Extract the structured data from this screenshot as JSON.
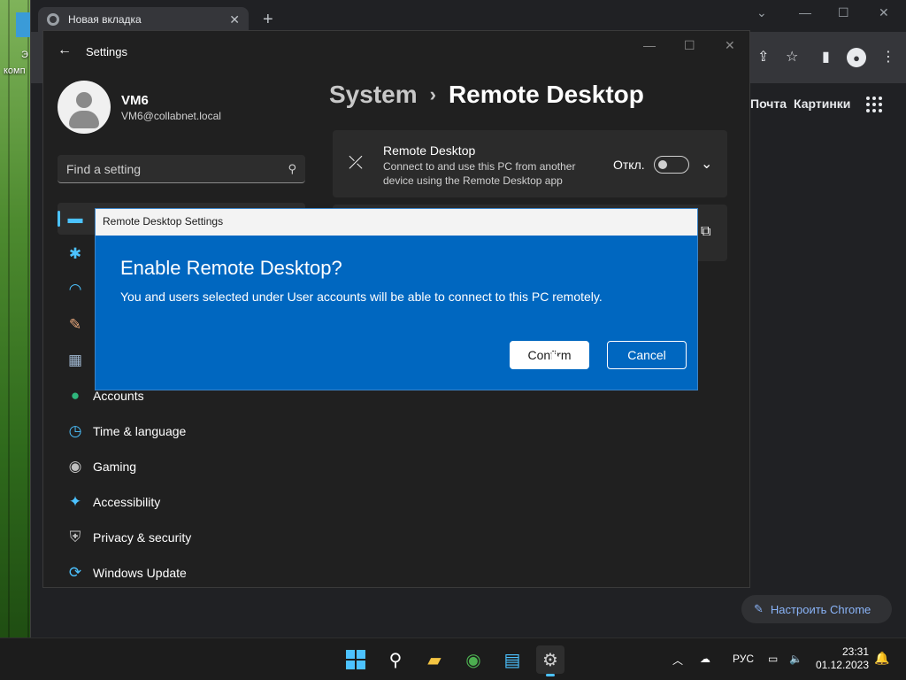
{
  "desktop": {
    "icon_fragment_1": "Э",
    "icon_fragment_2": "комп"
  },
  "chrome": {
    "tab_title": "Новая вкладка",
    "tab_close": "✕",
    "new_tab": "+",
    "window_controls": {
      "list": "⌄",
      "minimize": "—",
      "maximize": "☐",
      "close": "✕"
    },
    "toolbar_icons": {
      "share": "⇪",
      "bookmark": "☆",
      "sidepanel": "▮",
      "profile": "●",
      "menu": "⋮"
    },
    "links": {
      "mail": "Почта",
      "images": "Картинки"
    },
    "customize_label": "Настроить Chrome",
    "customize_icon": "✎"
  },
  "settings": {
    "window_title": "Settings",
    "back": "←",
    "window_controls": {
      "minimize": "—",
      "maximize": "☐",
      "close": "✕"
    },
    "user": {
      "name": "VM6",
      "email": "VM6@collabnet.local"
    },
    "search_placeholder": "Find a setting",
    "search_icon": "⚲",
    "nav": [
      {
        "icon": "▬",
        "label": "",
        "color": "#4cc2ff"
      },
      {
        "icon": "✱",
        "label": "",
        "color": "#4cc2ff"
      },
      {
        "icon": "◠",
        "label": "",
        "color": "#4cc2ff"
      },
      {
        "icon": "✎",
        "label": "",
        "color": "#e8a87c"
      },
      {
        "icon": "▦",
        "label": "",
        "color": "#9fb6cf"
      },
      {
        "icon": "●",
        "label": "Accounts",
        "color": "#2fb67c"
      },
      {
        "icon": "◷",
        "label": "Time & language",
        "color": "#4cc2ff"
      },
      {
        "icon": "◉",
        "label": "Gaming",
        "color": "#bfbfbf"
      },
      {
        "icon": "✦",
        "label": "Accessibility",
        "color": "#4cc2ff"
      },
      {
        "icon": "⛨",
        "label": "Privacy & security",
        "color": "#bfbfbf"
      },
      {
        "icon": "⟳",
        "label": "Windows Update",
        "color": "#4cc2ff"
      }
    ],
    "breadcrumb": {
      "parent": "System",
      "separator": "›",
      "current": "Remote Desktop"
    },
    "card_remote": {
      "icon": "⤫",
      "title": "Remote Desktop",
      "description": "Connect to and use this PC from another device using the Remote Desktop app",
      "state": "Откл.",
      "toggle_on": false,
      "chevron": "⌄"
    },
    "card_second": {
      "ext_icon": "⧉"
    }
  },
  "dialog": {
    "title": "Remote Desktop Settings",
    "heading": "Enable Remote Desktop?",
    "body": "You and users selected under User accounts will be able to connect to this PC remotely.",
    "confirm_label": "Confirm",
    "cancel_label": "Cancel"
  },
  "taskbar": {
    "apps": [
      {
        "name": "start",
        "icon": "start"
      },
      {
        "name": "search",
        "icon": "⚲"
      },
      {
        "name": "explorer",
        "icon": "▰"
      },
      {
        "name": "chrome",
        "icon": "◉"
      },
      {
        "name": "store",
        "icon": "▤"
      },
      {
        "name": "settings",
        "icon": "⚙"
      }
    ],
    "tray": {
      "overflow": "︿",
      "network": "☁",
      "language": "РУС",
      "display": "▭",
      "volume": "🔈"
    },
    "time": "23:31",
    "date": "01.12.2023",
    "notification_icon": "🔔"
  }
}
